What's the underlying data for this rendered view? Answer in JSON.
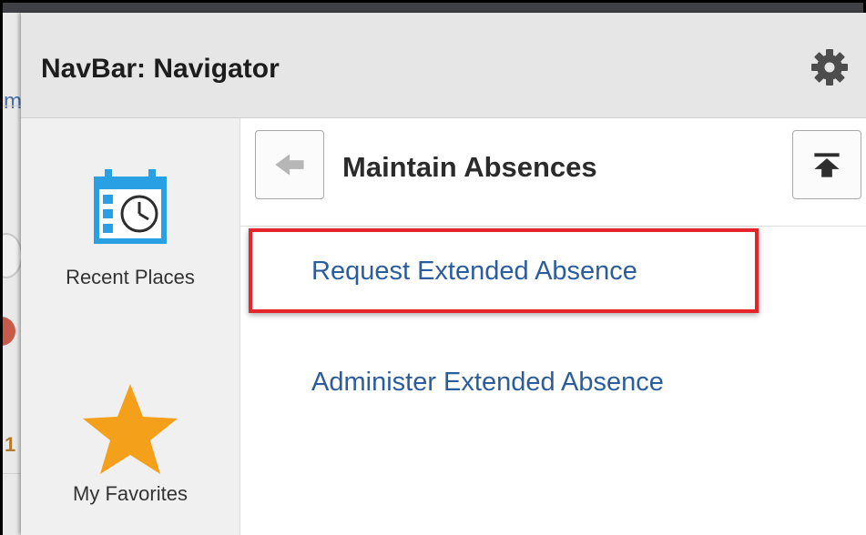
{
  "background_fragments": {
    "m_text": "m",
    "one_text": "1"
  },
  "navbar": {
    "title": "NavBar: Navigator",
    "settings_icon": "gear-icon"
  },
  "side_nav": {
    "items": [
      {
        "label": "Recent Places",
        "icon": "calendar-clock-icon"
      },
      {
        "label": "My Favorites",
        "icon": "star-icon"
      }
    ]
  },
  "folder": {
    "title": "Maintain Absences",
    "back_icon": "arrow-left-icon",
    "top_icon": "arrow-up-to-top-icon",
    "links": [
      {
        "label": "Request Extended Absence",
        "highlighted": true
      },
      {
        "label": "Administer Extended Absence",
        "highlighted": false
      }
    ]
  },
  "colors": {
    "link": "#2b5d9c",
    "highlight": "#e5242b",
    "star": "#f5a01a",
    "calendar": "#2aa0e4"
  }
}
